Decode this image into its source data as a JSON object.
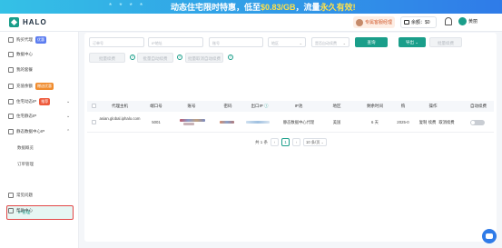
{
  "banner": {
    "decor": "* * * *",
    "text_prefix": "动态住宅限时特惠，低至",
    "price": "$0.83/GB",
    "text_suffix": "，流量",
    "highlight": "永久有效!"
  },
  "header": {
    "logo": "HALO",
    "manager_label": "专属客服经理",
    "balance_label": "余额：",
    "balance_value": "$0",
    "user_name": "黄丽"
  },
  "sidebar": {
    "items": [
      {
        "label": "购买代理",
        "badge": "优惠"
      },
      {
        "label": "数据中心"
      },
      {
        "label": "我的套餐"
      },
      {
        "label": "充值余额",
        "badge": "赠送优惠"
      },
      {
        "label": "住宅动态IP",
        "badge": "推荐"
      },
      {
        "label": "住宅静态IP"
      },
      {
        "label": "静态数据中心IP"
      }
    ],
    "subitems": [
      "数据概览",
      "订单管理",
      "IP管理"
    ],
    "bottom_items": [
      "常见问题",
      "帮助中心"
    ],
    "colors": {
      "badge_blue": "#5b7cf0",
      "badge_orange": "#f08c2e",
      "badge_red": "#ee5a3c",
      "accent": "#1a9e8a"
    }
  },
  "filters": {
    "order_no": "订单号",
    "ip": "IP地址",
    "account": "账号",
    "region": "地区",
    "auto_renew": "是否自动续费",
    "search_btn": "查询",
    "export_btn": "导出",
    "batch_btn": "批量续费"
  },
  "actions": {
    "batch_renew": "批量续费",
    "batch_auto_renew": "批量自动续费",
    "batch_cancel_auto": "批量取消自动续费"
  },
  "table": {
    "headers": [
      "代理主机",
      "端口号",
      "账号",
      "密码",
      "出口IP",
      "IP池",
      "地区",
      "剩余时间",
      "购",
      "操作",
      "自动续费"
    ],
    "rows": [
      {
        "host": "asian.global.iphalo.com",
        "port": "5001",
        "ip_pool": "静态数据中心代理",
        "region": "美国",
        "remaining": "6 天",
        "purchased": "2025-0",
        "op_copy": "复制",
        "op_renew": "续费",
        "op_cancel": "取消续费"
      }
    ]
  },
  "pagination": {
    "total": "共 1 条",
    "prev": "‹",
    "page": "1",
    "next": "›",
    "page_size": "10 条/页"
  }
}
